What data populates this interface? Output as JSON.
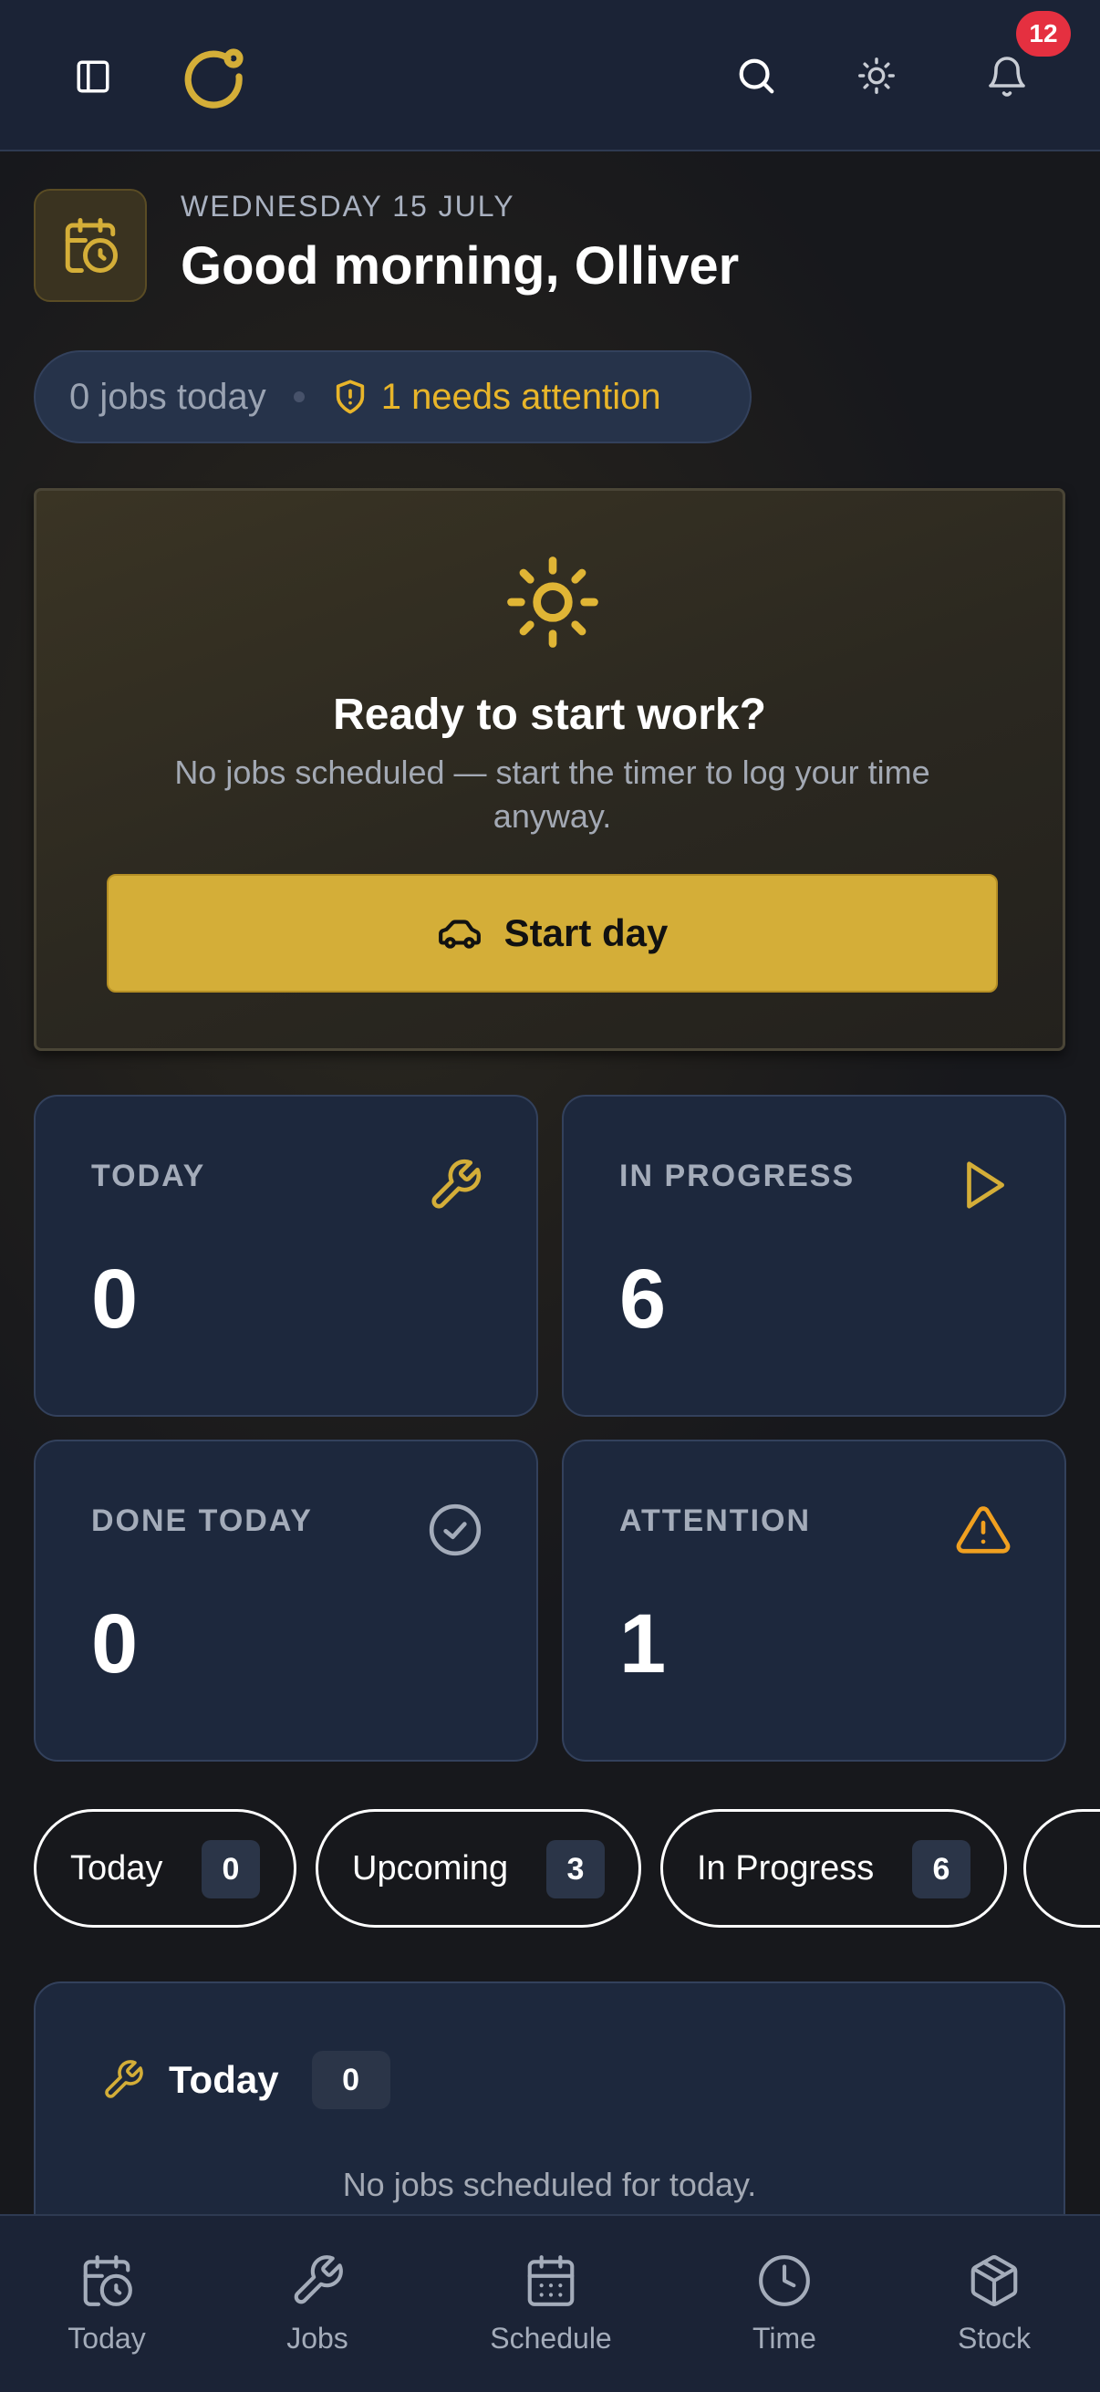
{
  "header": {
    "notification_count": "12"
  },
  "greeting": {
    "date": "WEDNESDAY 15 JULY",
    "title": "Good morning, Olliver"
  },
  "summary": {
    "jobs_today": "0 jobs today",
    "attention": "1 needs attention"
  },
  "ready_card": {
    "title": "Ready to start work?",
    "subtitle": "No jobs scheduled — start the timer to log your time anyway.",
    "button_label": "Start day"
  },
  "stats": [
    {
      "label": "TODAY",
      "value": "0",
      "icon": "wrench-icon"
    },
    {
      "label": "IN PROGRESS",
      "value": "6",
      "icon": "play-icon"
    },
    {
      "label": "DONE TODAY",
      "value": "0",
      "icon": "check-circle-icon"
    },
    {
      "label": "ATTENTION",
      "value": "1",
      "icon": "warning-icon"
    }
  ],
  "tabs": [
    {
      "label": "Today",
      "count": "0"
    },
    {
      "label": "Upcoming",
      "count": "3"
    },
    {
      "label": "In Progress",
      "count": "6"
    }
  ],
  "today_section": {
    "title": "Today",
    "count": "0",
    "empty_text": "No jobs scheduled for today."
  },
  "nav": [
    {
      "label": "Today",
      "icon": "calendar-clock-icon"
    },
    {
      "label": "Jobs",
      "icon": "wrench-icon"
    },
    {
      "label": "Schedule",
      "icon": "calendar-icon"
    },
    {
      "label": "Time",
      "icon": "clock-icon"
    },
    {
      "label": "Stock",
      "icon": "box-icon"
    }
  ],
  "colors": {
    "accent": "#d4ae38",
    "attention": "#e8b52a",
    "warning": "#f0a020",
    "badge": "#e53040",
    "surface": "#1d283d",
    "topbar": "#1b2336"
  }
}
